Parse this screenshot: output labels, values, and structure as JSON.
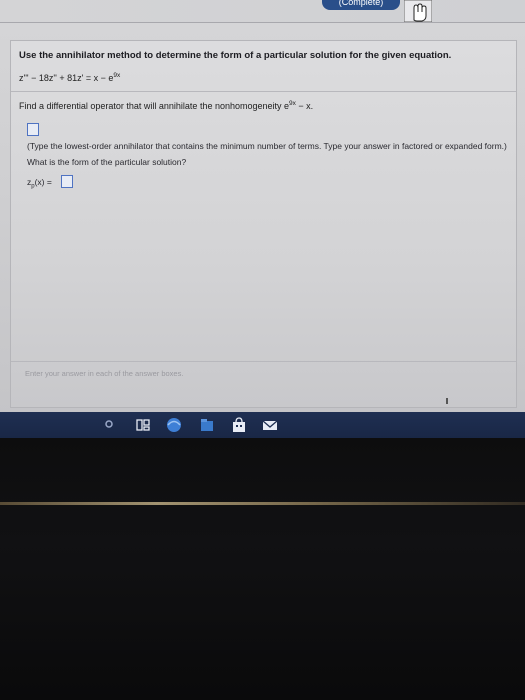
{
  "header": {
    "top_button_label": "(Complete)"
  },
  "question": {
    "instruction": "Use the annihilator method to determine the form of a particular solution for the given equation.",
    "equation_main": "z''' − 18z'' + 81z' = x − e",
    "equation_exp": "9x"
  },
  "part1": {
    "prompt_main": "Find a differential operator that will annihilate the nonhomogeneity e",
    "prompt_exp": "9x",
    "prompt_tail": " − x.",
    "hint": "(Type the lowest-order annihilator that contains the minimum number of terms. Type your answer in factored or expanded form.)"
  },
  "part2": {
    "question": "What is the form of the particular solution?",
    "zp_label": "z",
    "zp_sub": "p",
    "zp_tail": "(x) ="
  },
  "footer": {
    "note": "Enter your answer in each of the answer boxes."
  },
  "colors": {
    "taskbar": "#1f2f52",
    "answer_box_border": "#4f73c2",
    "button_blue": "#2a4f8a"
  }
}
